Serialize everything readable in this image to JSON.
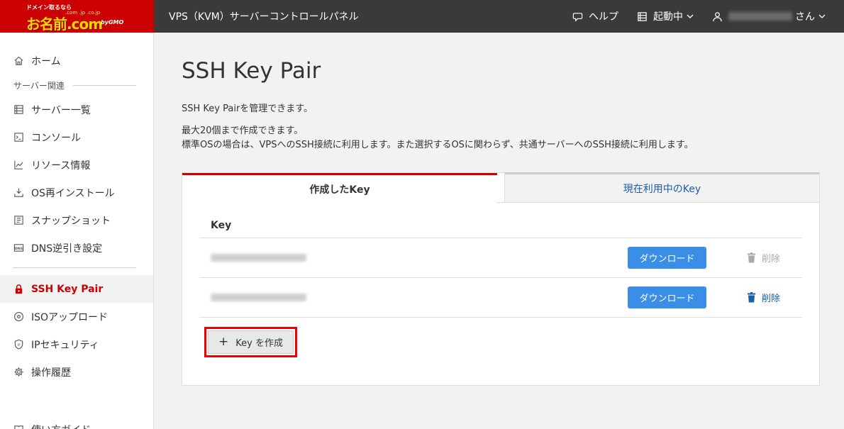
{
  "logo": {
    "tagline": "ドメイン取るなら",
    "domains": ".com .jp .co.jp",
    "main": "お名前.com",
    "by": "byGMO"
  },
  "header": {
    "title": "VPS（KVM）サーバーコントロールパネル",
    "help": "ヘルプ",
    "status": "起動中",
    "user_suffix": "さん"
  },
  "sidebar": {
    "home": "ホーム",
    "section_server": "サーバー関連",
    "items": [
      {
        "label": "サーバー一覧",
        "icon": "server-list-icon"
      },
      {
        "label": "コンソール",
        "icon": "console-icon"
      },
      {
        "label": "リソース情報",
        "icon": "chart-icon"
      },
      {
        "label": "OS再インストール",
        "icon": "reinstall-icon"
      },
      {
        "label": "スナップショット",
        "icon": "snapshot-icon"
      },
      {
        "label": "DNS逆引き設定",
        "icon": "dns-icon"
      }
    ],
    "items2": [
      {
        "label": "SSH Key Pair",
        "icon": "lock-icon",
        "active": true
      },
      {
        "label": "ISOアップロード",
        "icon": "disc-icon"
      },
      {
        "label": "IPセキュリティ",
        "icon": "shield-icon"
      },
      {
        "label": "操作履歴",
        "icon": "gear-icon"
      }
    ],
    "guide": "使い方ガイド"
  },
  "main": {
    "title": "SSH Key Pair",
    "desc1": "SSH Key Pairを管理できます。",
    "desc2": "最大20個まで作成できます。",
    "desc3": "標準OSの場合は、VPSへのSSH接続に利用します。また選択するOSに関わらず、共通サーバーへのSSH接続に利用します。",
    "tabs": [
      {
        "label": "作成したKey",
        "active": true
      },
      {
        "label": "現在利用中のKey",
        "active": false
      }
    ],
    "table_header": "Key",
    "download_label": "ダウンロード",
    "delete_label": "削除",
    "create_label": "Key を作成"
  },
  "colors": {
    "brand_red": "#cc0000",
    "header_bg": "#3a3a3a",
    "button_blue": "#3a8ee6",
    "link_blue": "#1b5ea8",
    "highlight_red": "#ee0000"
  }
}
